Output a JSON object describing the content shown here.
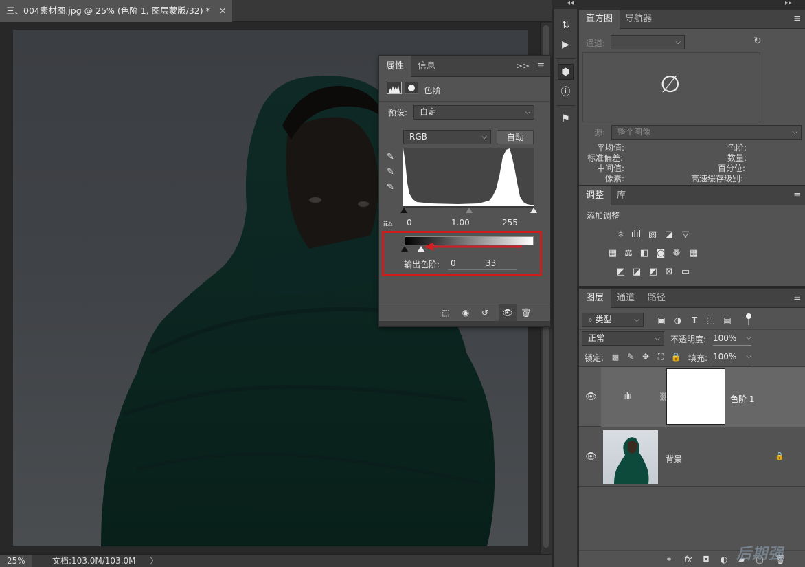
{
  "document": {
    "tab_title": "三、004素材图.jpg @ 25% (色阶 1, 图层蒙版/32) *",
    "close": "×"
  },
  "statusbar": {
    "zoom": "25%",
    "doc_info": "文档:103.0M/103.0M",
    "arrow": "〉"
  },
  "properties": {
    "tabs": [
      "属性",
      "信息"
    ],
    "expand": ">>",
    "menu": "≡",
    "title": "色阶",
    "preset_label": "预设:",
    "preset_value": "自定",
    "channel_value": "RGB",
    "auto_button": "自动",
    "input_levels": {
      "black": "0",
      "gamma": "1.00",
      "white": "255"
    },
    "output_label": "输出色阶:",
    "output_black": "0",
    "output_white": "33",
    "output_white_fraction": 0.13
  },
  "histogram_panel": {
    "tabs": [
      "直方图",
      "导航器"
    ],
    "channel_label": "通道:",
    "source_label": "源:",
    "source_value": "整个图像",
    "no_data_icon": "∅",
    "stats_left": [
      "平均值:",
      "标准偏差:",
      "中间值:",
      "像素:"
    ],
    "stats_right": [
      "色阶:",
      "数量:",
      "百分位:",
      "高速缓存级别:"
    ]
  },
  "adjustments_panel": {
    "tabs": [
      "调整",
      "库"
    ],
    "add_label": "添加调整"
  },
  "layers_panel": {
    "tabs": [
      "图层",
      "通道",
      "路径"
    ],
    "filter_label": "类型",
    "blend_mode": "正常",
    "opacity_label": "不透明度:",
    "opacity_value": "100%",
    "lock_label": "锁定:",
    "fill_label": "填充:",
    "fill_value": "100%",
    "layers": [
      {
        "name": "色阶 1"
      },
      {
        "name": "背景"
      }
    ]
  },
  "watermark": "后期强",
  "colors": {
    "panel_bg": "#535353",
    "highlight_box": "#d11a1a",
    "arrow": "#d42020"
  }
}
